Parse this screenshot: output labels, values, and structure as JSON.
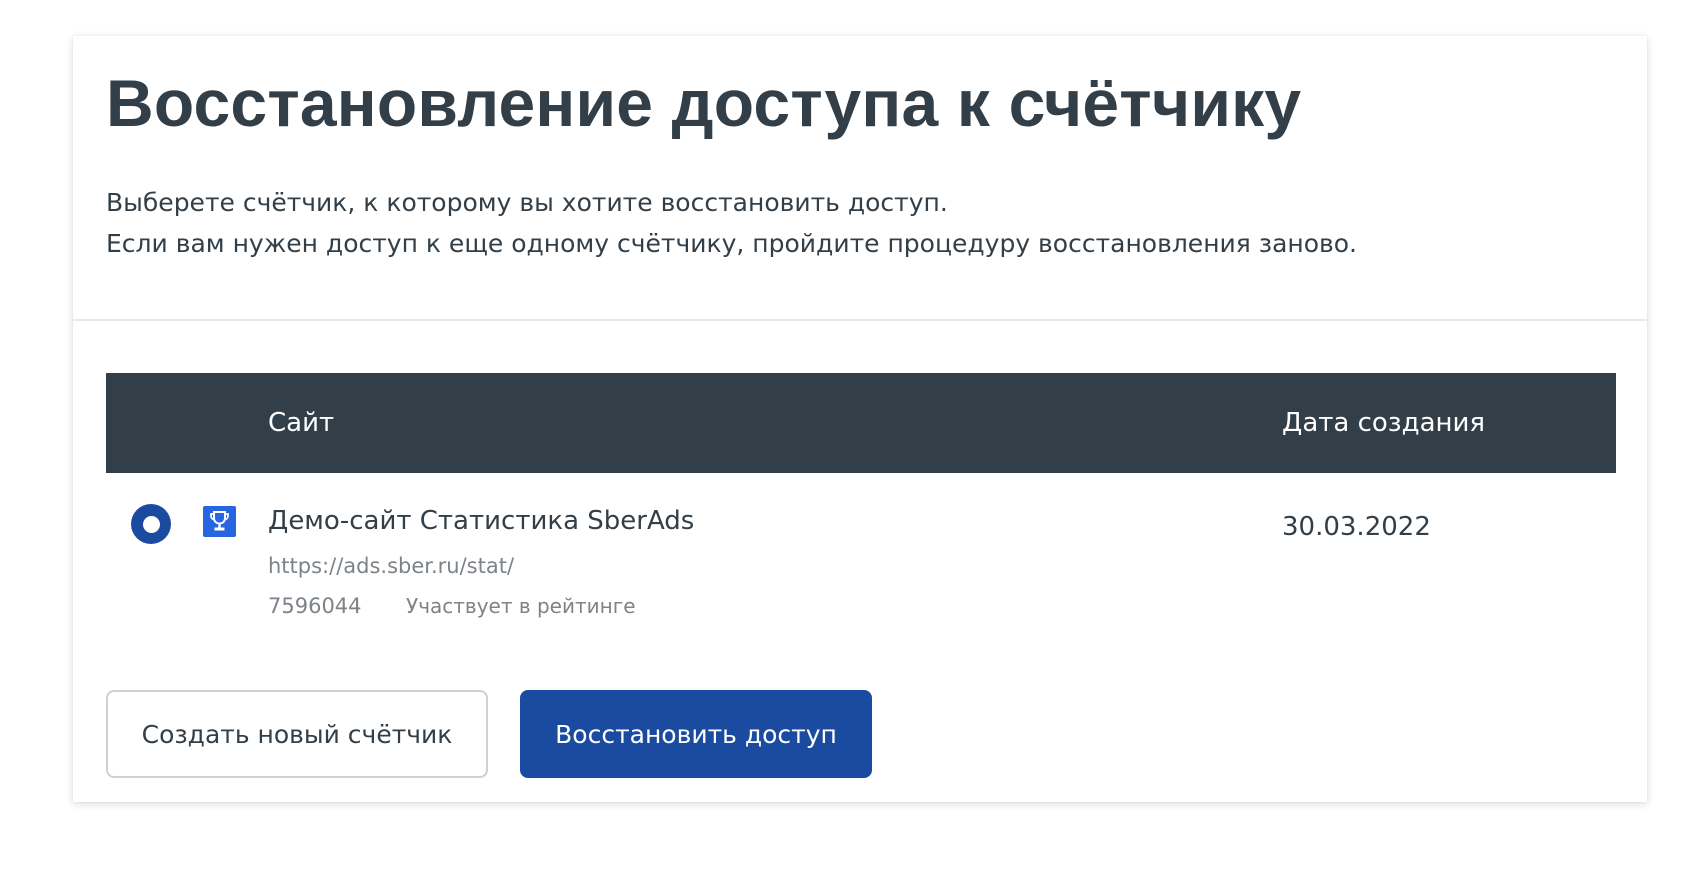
{
  "page": {
    "title": "Восстановление доступа к счётчику",
    "description_line1": "Выберете счётчик, к которому вы хотите восстановить доступ.",
    "description_line2": "Если вам нужен доступ к еще одному счётчику, пройдите процедуру восстановления заново."
  },
  "table": {
    "columns": {
      "site": "Сайт",
      "created": "Дата создания"
    },
    "rows": [
      {
        "selected": true,
        "icon": "trophy-icon",
        "name": "Демо-сайт Статистика SberAds",
        "url": "https://ads.sber.ru/stat/",
        "counter_id": "7596044",
        "rating_status": "Участвует в рейтинге",
        "created": "30.03.2022"
      }
    ]
  },
  "actions": {
    "create_label": "Создать новый счётчик",
    "restore_label": "Восстановить доступ"
  },
  "colors": {
    "primary": "#1a4ba0",
    "header_bg": "#333f48",
    "text": "#333f48",
    "muted": "#7d8388",
    "icon_bg": "#2766e0"
  }
}
